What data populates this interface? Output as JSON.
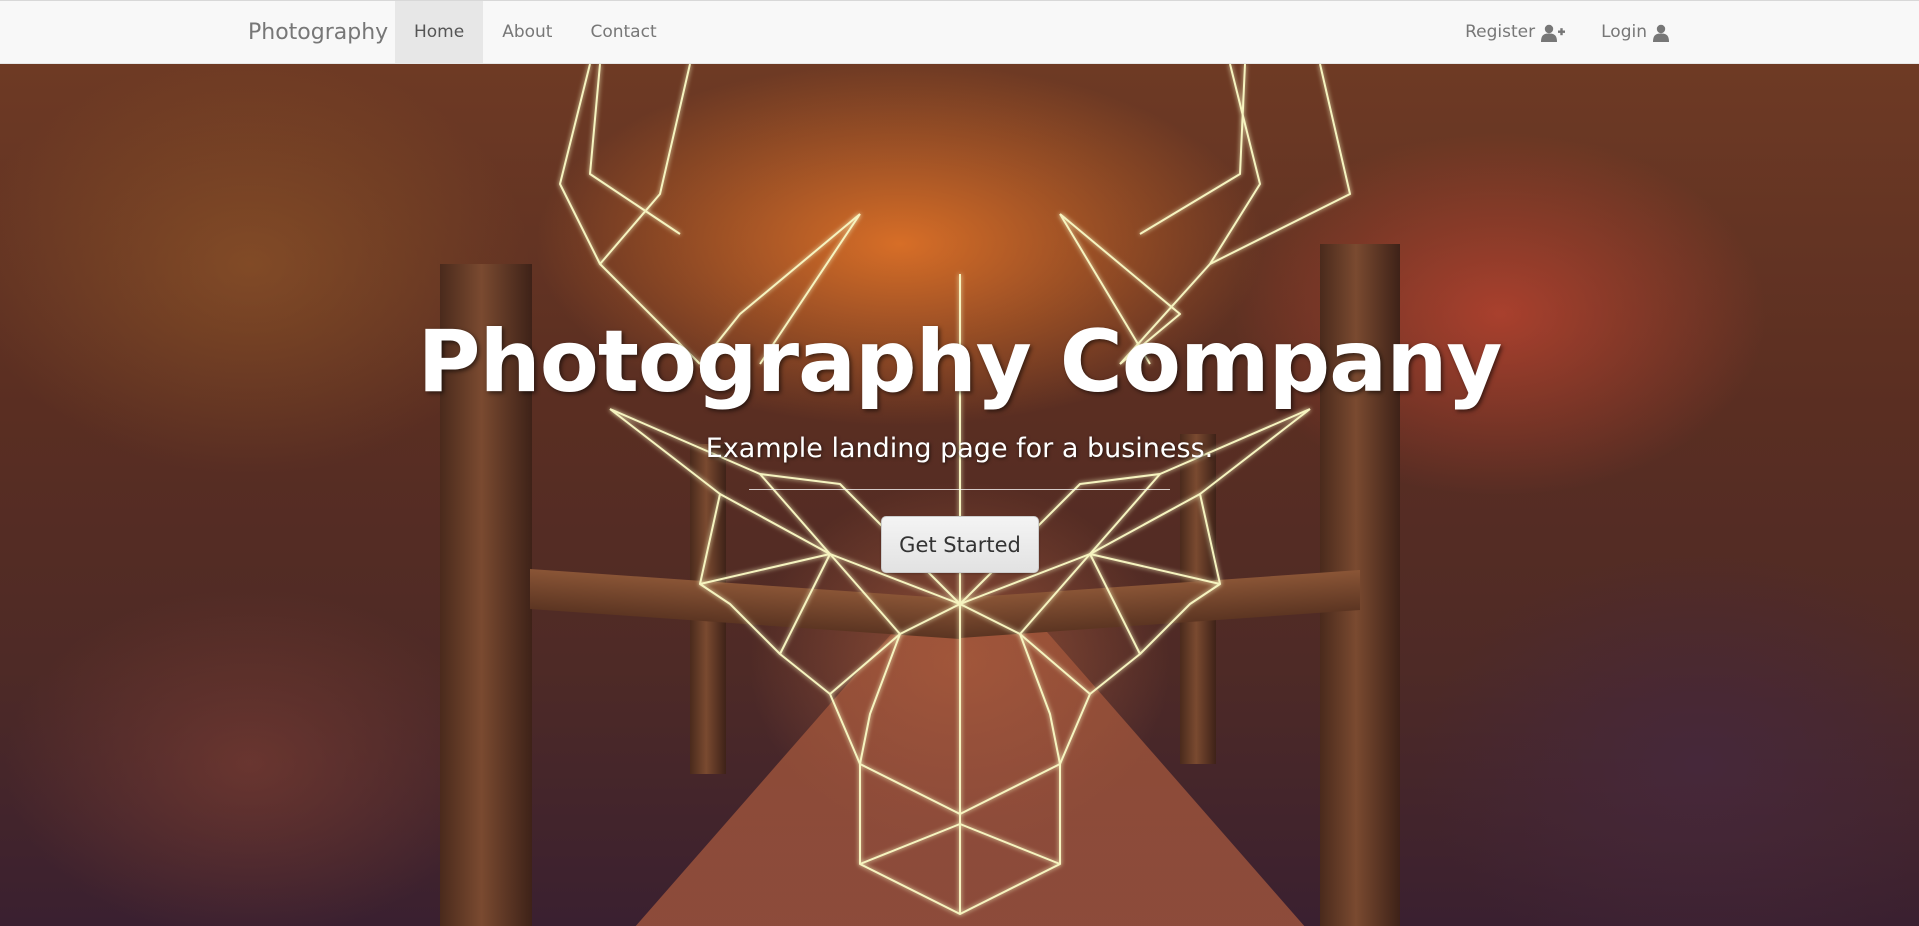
{
  "navbar": {
    "brand": "Photography",
    "links": [
      {
        "label": "Home",
        "active": true
      },
      {
        "label": "About",
        "active": false
      },
      {
        "label": "Contact",
        "active": false
      }
    ],
    "right": [
      {
        "label": "Register",
        "icon": "user-plus-icon"
      },
      {
        "label": "Login",
        "icon": "user-icon"
      }
    ]
  },
  "hero": {
    "title": "Photography Company",
    "subtitle": "Example landing page for a business.",
    "button": "Get Started"
  },
  "colors": {
    "navbar_bg": "#f8f8f8",
    "nav_text": "#777777",
    "active_bg": "#e7e7e7",
    "deer_line": "#f6f4c0"
  }
}
